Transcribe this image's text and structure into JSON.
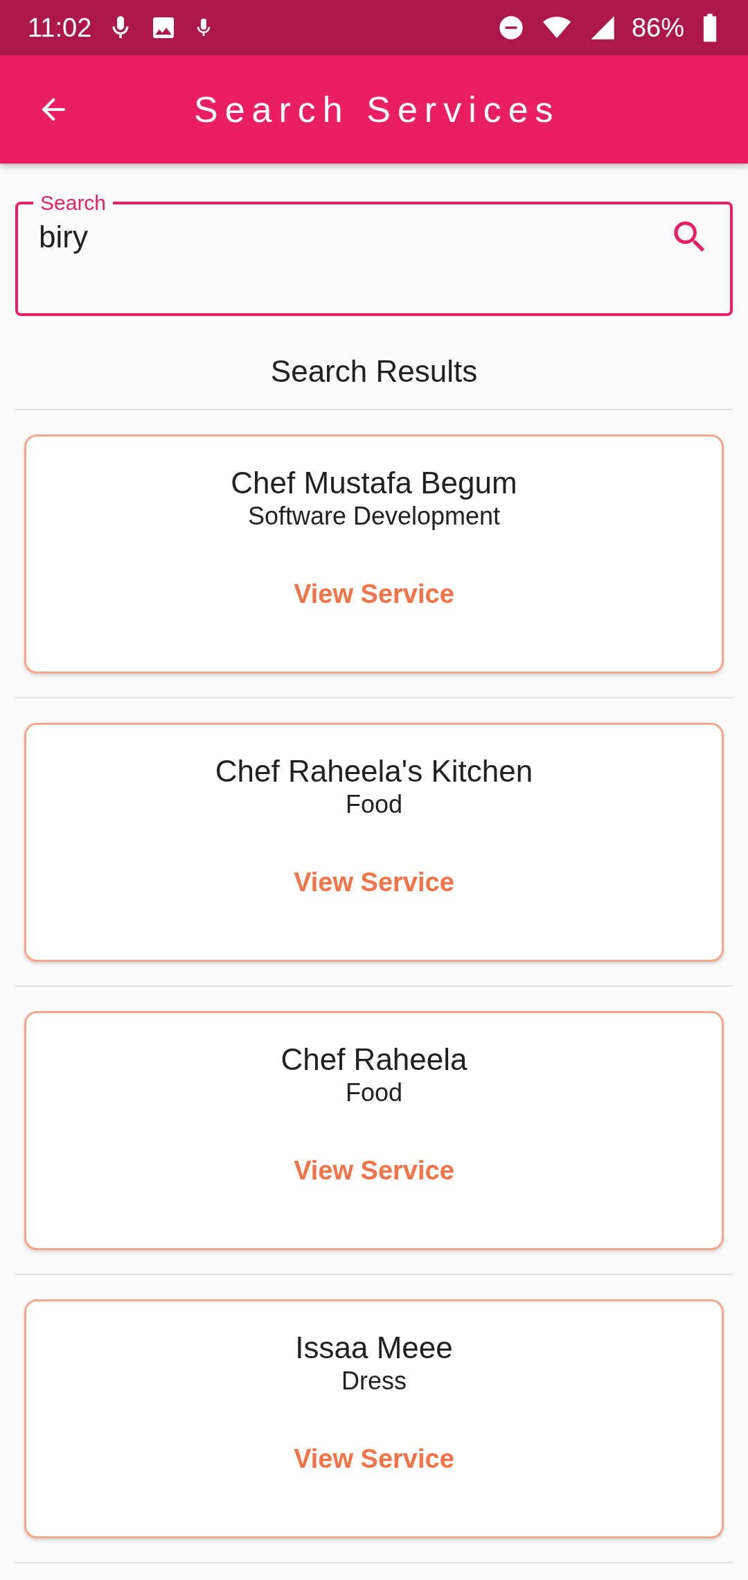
{
  "status_bar": {
    "time": "11:02",
    "battery": "86%"
  },
  "app_bar": {
    "title": "Search Services"
  },
  "search": {
    "label": "Search",
    "value": "biry"
  },
  "results_heading": "Search Results",
  "results": [
    {
      "name": "Chef Mustafa Begum",
      "category": "Software Development",
      "action": "View Service"
    },
    {
      "name": "Chef Raheela's Kitchen",
      "category": "Food",
      "action": "View Service"
    },
    {
      "name": "Chef Raheela",
      "category": "Food",
      "action": "View Service"
    },
    {
      "name": "Issaa Meee",
      "category": "Dress",
      "action": "View Service"
    }
  ]
}
